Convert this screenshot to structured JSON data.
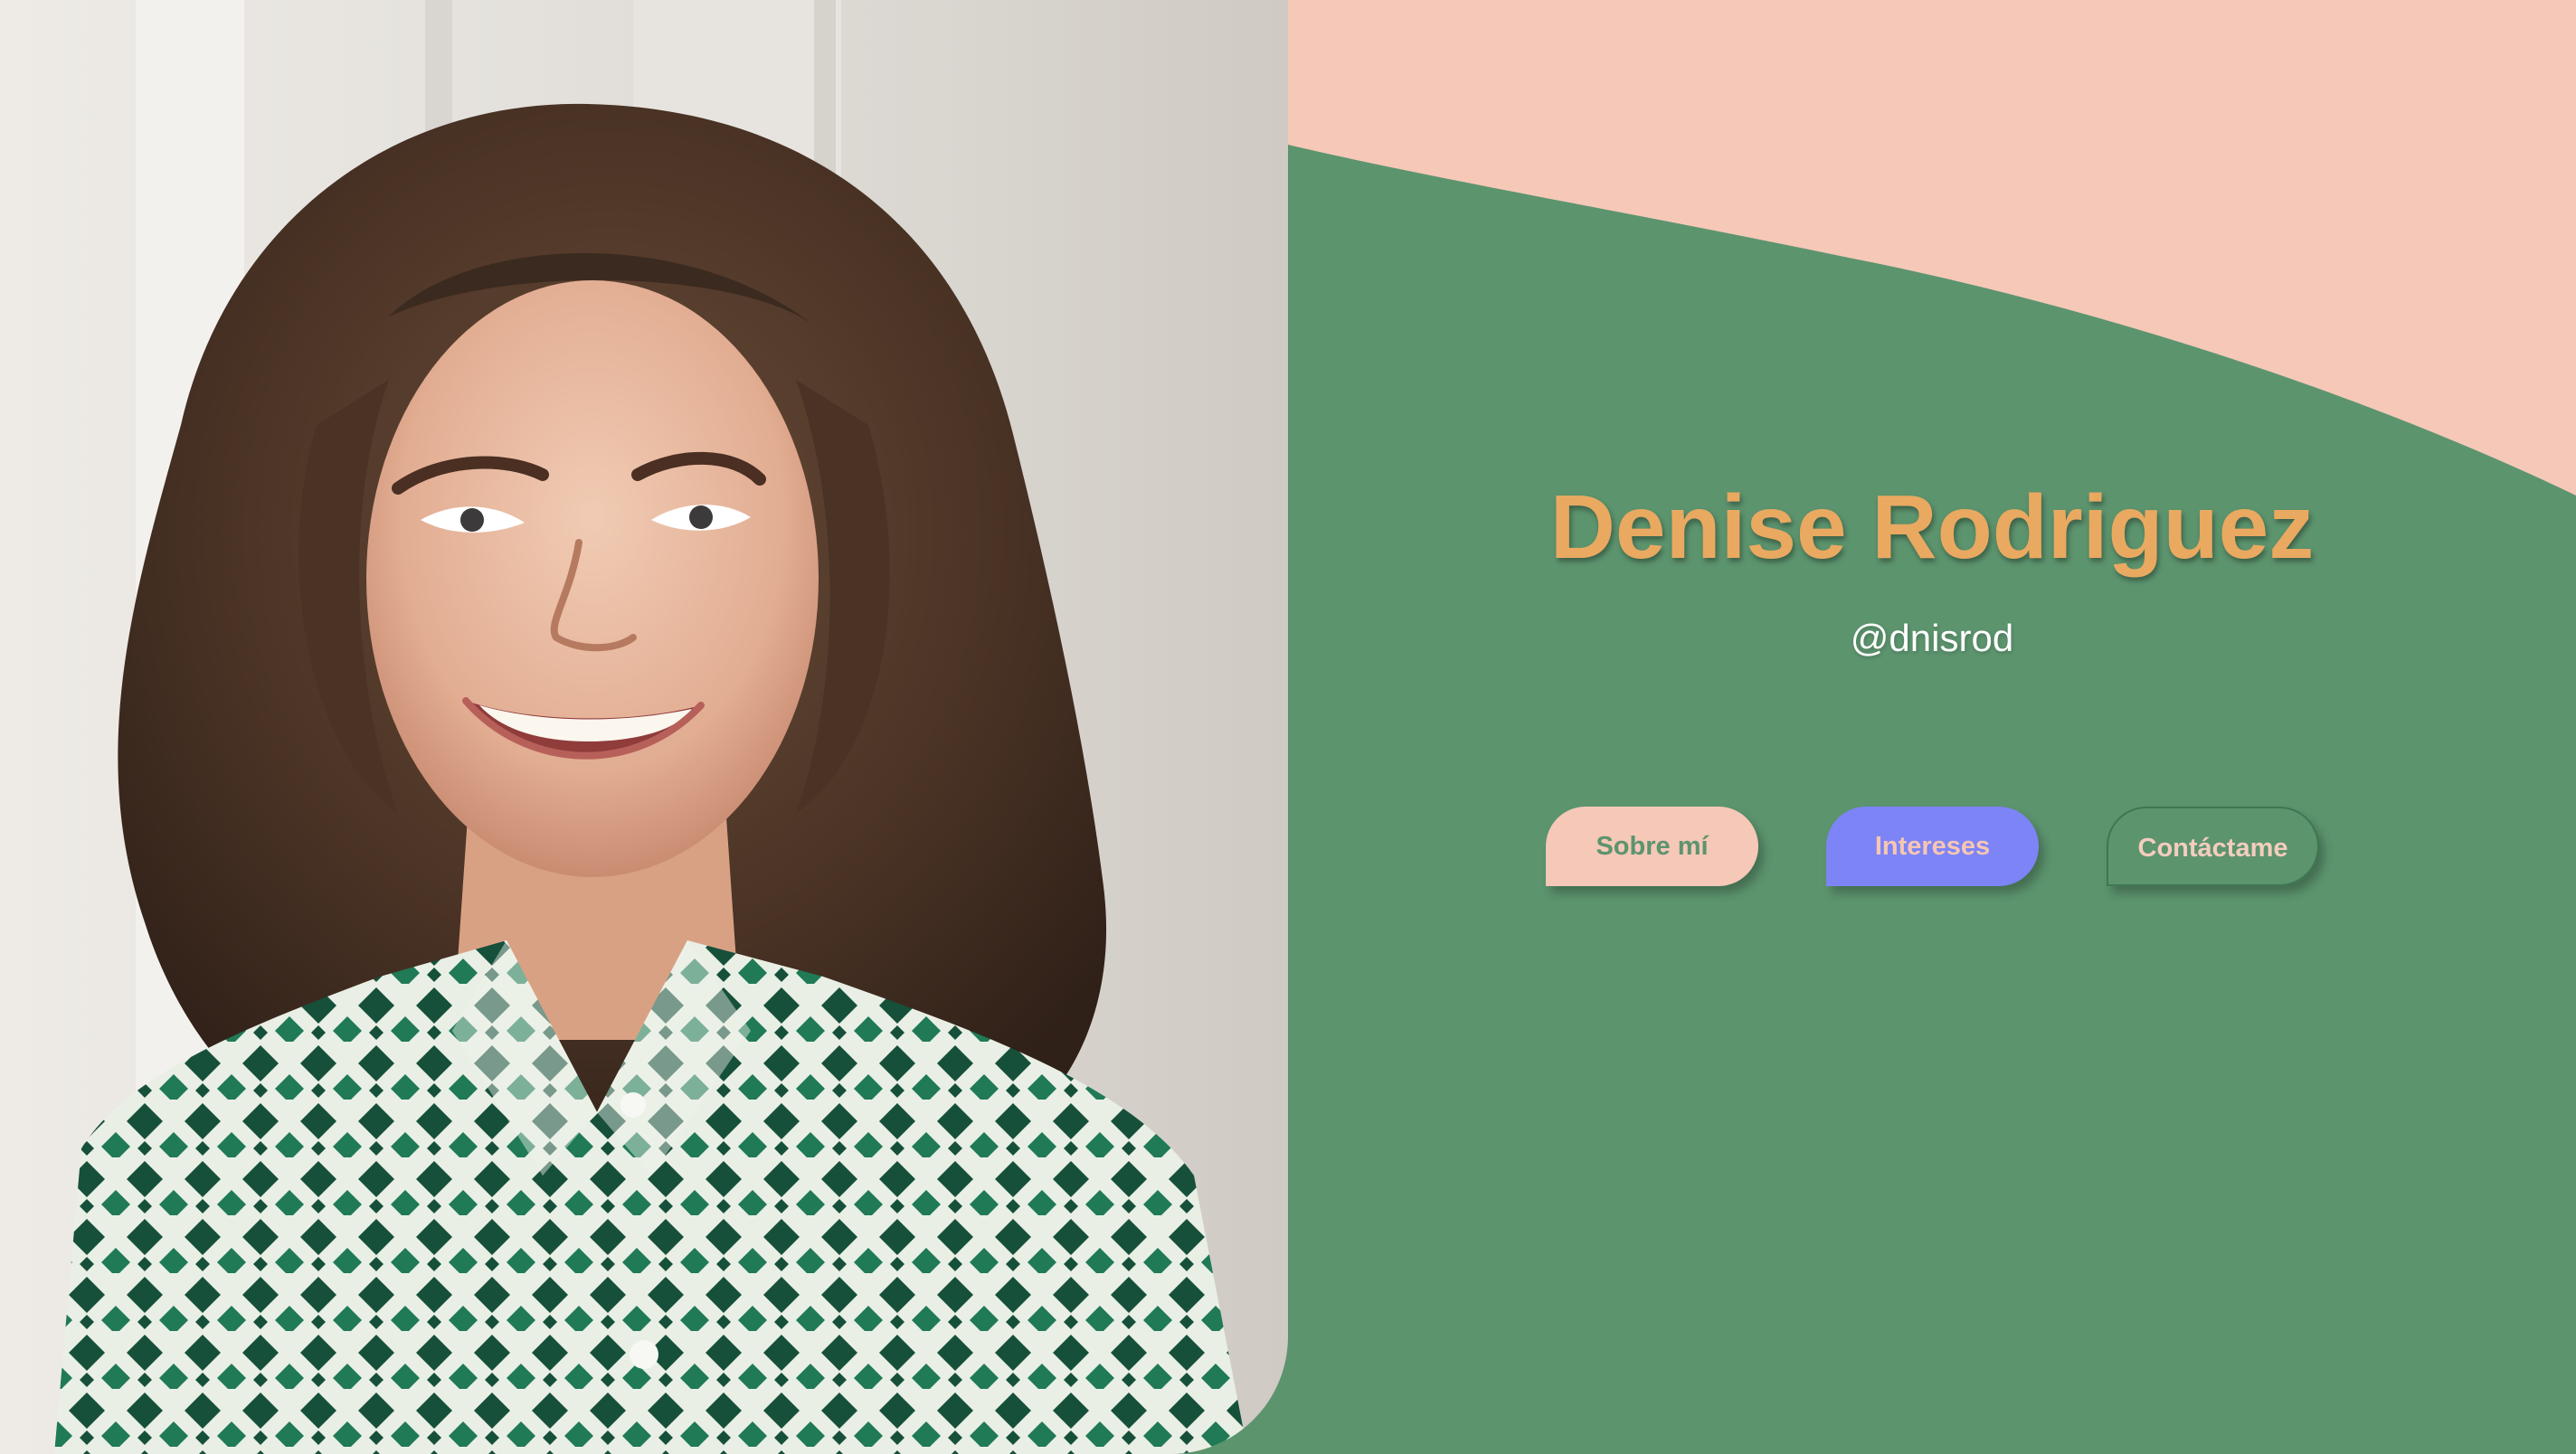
{
  "profile": {
    "name": "Denise Rodriguez",
    "handle": "@dnisrod"
  },
  "nav": {
    "about_label": "Sobre mí",
    "interests_label": "Intereses",
    "contact_label": "Contáctame"
  },
  "colors": {
    "background_green": "#5c946e",
    "blush_pink": "#f5c8b8",
    "name_orange": "#e9a961",
    "button_blue": "#7d84f5",
    "handle_white": "#ffffff"
  },
  "photo": {
    "subject": "smiling woman with curly brown hair in green diamond patterned shirt"
  }
}
